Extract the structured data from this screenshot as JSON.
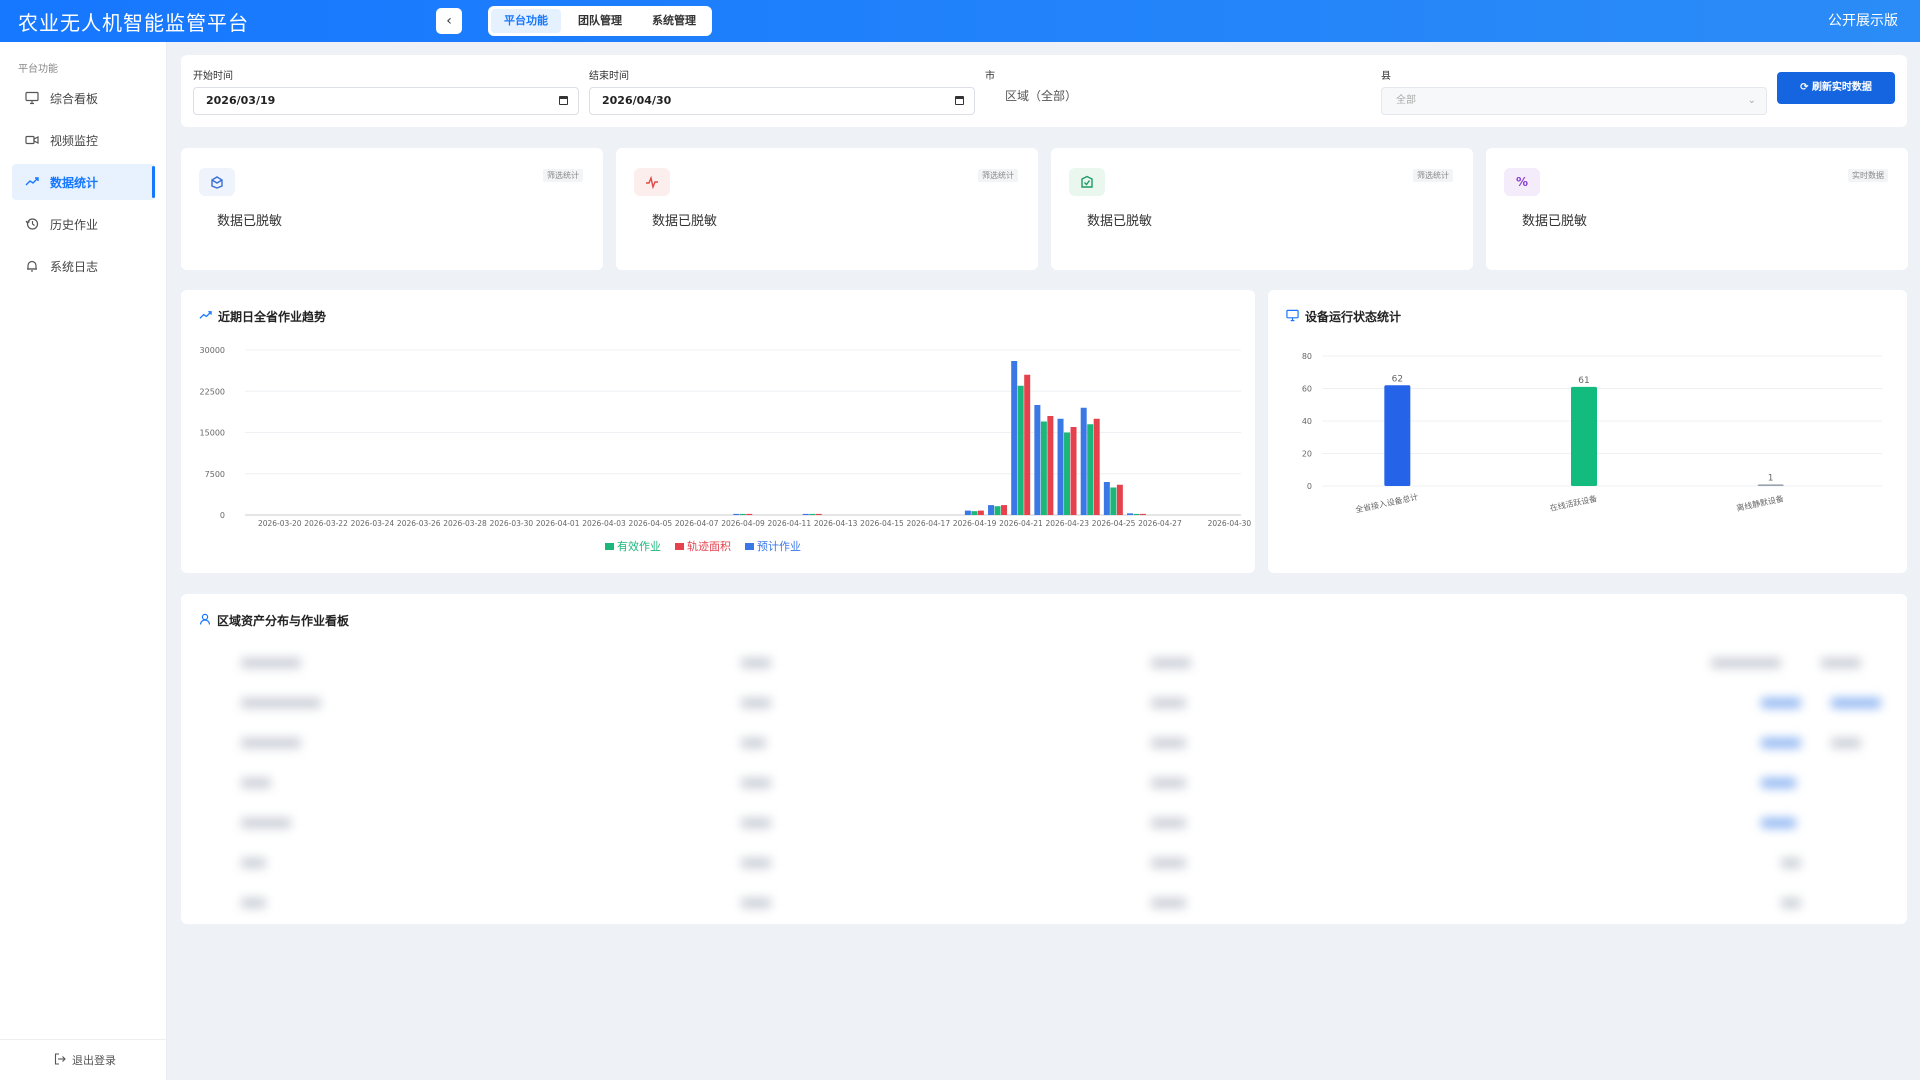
{
  "header": {
    "title": "农业无人机智能监管平台",
    "collapse_icon": "chevron-left-icon",
    "tabs": [
      {
        "label": "平台功能",
        "active": true
      },
      {
        "label": "团队管理",
        "active": false
      },
      {
        "label": "系统管理",
        "active": false
      }
    ],
    "public_label": "公开展示版"
  },
  "sidebar": {
    "section_label": "平台功能",
    "items": [
      {
        "label": "综合看板",
        "icon": "monitor-icon",
        "active": false
      },
      {
        "label": "视频监控",
        "icon": "video-camera-icon",
        "active": false
      },
      {
        "label": "数据统计",
        "icon": "trend-icon",
        "active": true
      },
      {
        "label": "历史作业",
        "icon": "history-icon",
        "active": false
      },
      {
        "label": "系统日志",
        "icon": "bell-icon",
        "active": false
      }
    ],
    "logout_label": "退出登录"
  },
  "filters": {
    "start_label": "开始时间",
    "start_value": "2026/03/19",
    "end_label": "结束时间",
    "end_value": "2026/04/30",
    "city_label": "市",
    "city_value": "区域（全部）",
    "county_label": "县",
    "county_placeholder": "全部",
    "refresh_label": "刷新实时数据"
  },
  "stats": [
    {
      "tag": "筛选统计",
      "text": "数据已脱敏",
      "icon": "cube-icon",
      "accent": "#3a6fd8",
      "bg": "#eef3fc"
    },
    {
      "tag": "筛选统计",
      "text": "数据已脱敏",
      "icon": "pulse-icon",
      "accent": "#e04848",
      "bg": "#fdeeee"
    },
    {
      "tag": "筛选统计",
      "text": "数据已脱敏",
      "icon": "shield-check-icon",
      "accent": "#1f9b63",
      "bg": "#eaf7ef"
    },
    {
      "tag": "实时数据",
      "text": "数据已脱敏",
      "icon": "percent-icon",
      "accent": "#8a3fd1",
      "bg": "#f4ecfb"
    }
  ],
  "trend_chart": {
    "title": "近期日全省作业趋势",
    "title_icon": "trend-icon",
    "legend": [
      {
        "name": "有效作业",
        "color": "#1bb77a"
      },
      {
        "name": "轨迹面积",
        "color": "#e5424d"
      },
      {
        "name": "预计作业",
        "color": "#3a78e6"
      }
    ]
  },
  "device_chart": {
    "title": "设备运行状态统计",
    "title_icon": "monitor-icon"
  },
  "table_section": {
    "title": "区域资产分布与作业看板",
    "title_icon": "user-icon"
  },
  "chart_data": [
    {
      "type": "bar",
      "title": "近期日全省作业趋势",
      "ylim": [
        0,
        30000
      ],
      "yticks": [
        "0",
        "7500",
        "15000",
        "22500",
        "30000"
      ],
      "x_tick_labels": [
        "2026-03-20",
        "2026-03-22",
        "2026-03-24",
        "2026-03-26",
        "2026-03-28",
        "2026-03-30",
        "2026-04-01",
        "2026-04-03",
        "2026-04-05",
        "2026-04-07",
        "2026-04-09",
        "2026-04-11",
        "2026-04-13",
        "2026-04-15",
        "2026-04-17",
        "2026-04-19",
        "2026-04-21",
        "2026-04-23",
        "2026-04-25",
        "2026-04-27",
        "2026-04-30"
      ],
      "categories": [
        "2026-03-19",
        "2026-03-20",
        "2026-03-21",
        "2026-03-22",
        "2026-03-23",
        "2026-03-24",
        "2026-03-25",
        "2026-03-26",
        "2026-03-27",
        "2026-03-28",
        "2026-03-29",
        "2026-03-30",
        "2026-03-31",
        "2026-04-01",
        "2026-04-02",
        "2026-04-03",
        "2026-04-04",
        "2026-04-05",
        "2026-04-06",
        "2026-04-07",
        "2026-04-08",
        "2026-04-09",
        "2026-04-10",
        "2026-04-11",
        "2026-04-12",
        "2026-04-13",
        "2026-04-14",
        "2026-04-15",
        "2026-04-16",
        "2026-04-17",
        "2026-04-18",
        "2026-04-19",
        "2026-04-20",
        "2026-04-21",
        "2026-04-22",
        "2026-04-23",
        "2026-04-24",
        "2026-04-25",
        "2026-04-26",
        "2026-04-27",
        "2026-04-28",
        "2026-04-29",
        "2026-04-30"
      ],
      "series": [
        {
          "name": "预计作业",
          "color": "#3a78e6",
          "values": [
            0,
            0,
            0,
            0,
            0,
            0,
            0,
            0,
            0,
            0,
            0,
            0,
            0,
            0,
            0,
            0,
            0,
            0,
            0,
            0,
            0,
            200,
            0,
            0,
            200,
            0,
            0,
            0,
            0,
            0,
            0,
            800,
            1800,
            28000,
            20000,
            17500,
            19500,
            6000,
            300,
            0,
            0,
            0,
            0
          ]
        },
        {
          "name": "有效作业",
          "color": "#1bb77a",
          "values": [
            0,
            0,
            0,
            0,
            0,
            0,
            0,
            0,
            0,
            0,
            0,
            0,
            0,
            0,
            0,
            0,
            0,
            0,
            0,
            0,
            0,
            200,
            0,
            0,
            200,
            0,
            0,
            0,
            0,
            0,
            0,
            700,
            1600,
            23500,
            17000,
            15000,
            16500,
            5000,
            200,
            0,
            0,
            0,
            0
          ]
        },
        {
          "name": "轨迹面积",
          "color": "#e5424d",
          "values": [
            0,
            0,
            0,
            0,
            0,
            0,
            0,
            0,
            0,
            0,
            0,
            0,
            0,
            0,
            0,
            0,
            0,
            0,
            0,
            0,
            0,
            200,
            0,
            0,
            200,
            0,
            0,
            0,
            0,
            0,
            0,
            800,
            1800,
            25500,
            18000,
            16000,
            17500,
            5500,
            200,
            0,
            0,
            0,
            0
          ]
        }
      ],
      "legend_position": "bottom"
    },
    {
      "type": "bar",
      "title": "设备运行状态统计",
      "ylim": [
        0,
        80
      ],
      "yticks": [
        "0",
        "20",
        "40",
        "60",
        "80"
      ],
      "categories": [
        "全省接入设备总计",
        "在线活跃设备",
        "离线静默设备"
      ],
      "values": [
        62,
        61,
        1
      ],
      "colors": [
        "#2563e8",
        "#13bb7e",
        "#9aa3ad"
      ]
    }
  ]
}
